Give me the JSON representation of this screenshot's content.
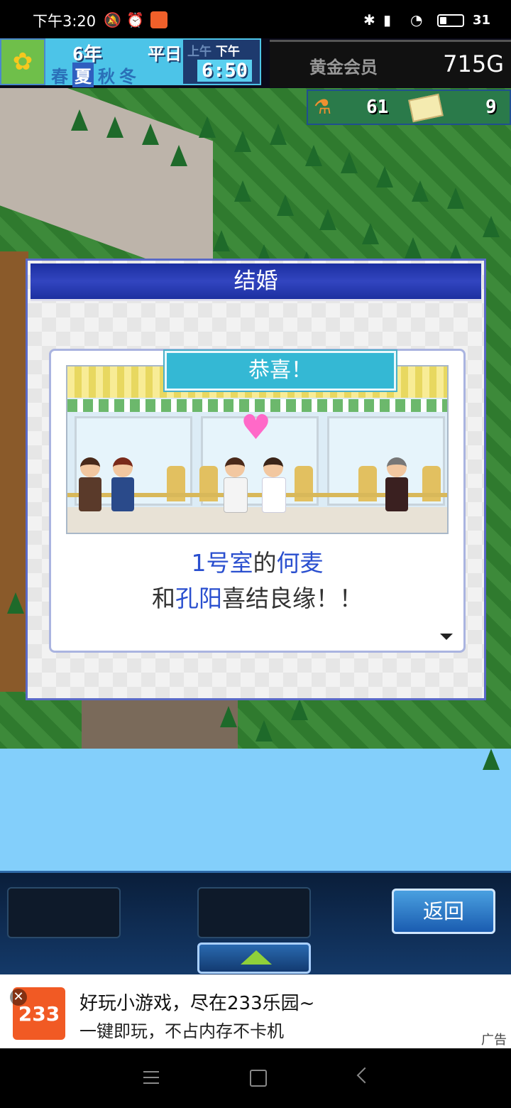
{
  "status_bar": {
    "time": "下午3:20",
    "icons": [
      "mute-icon",
      "alarm-icon",
      "app-badge-icon",
      "bluetooth-icon",
      "signal-icon",
      "wifi-icon",
      "battery-icon"
    ],
    "battery_percent": "31",
    "battery_level": 0.31
  },
  "hud": {
    "season_icon": "sunflower-icon",
    "year": "6年",
    "weekday": "平日",
    "seasons": [
      "春",
      "夏",
      "秋",
      "冬"
    ],
    "active_season": "夏",
    "ampm": [
      "上午",
      "下午"
    ],
    "active_ampm": "下午",
    "clock": "6:50",
    "member_label": "黄金会员",
    "gold": "715G",
    "research_points": "61",
    "tickets": "9"
  },
  "dialog": {
    "title": "结婚",
    "banner": "恭喜！",
    "message_line1": {
      "room": "1号室",
      "connector": "的",
      "name": "何麦"
    },
    "message_line2": {
      "prefix": "和",
      "name": "孔阳",
      "suffix": "喜结良缘！！"
    }
  },
  "bottom_hud": {
    "back_label": "返回"
  },
  "ad": {
    "logo_text": "233",
    "line1": "好玩小游戏，尽在233乐园~",
    "line2": "一键即玩，不占内存不卡机",
    "tag": "广告"
  },
  "colors": {
    "dialog_title_bg": "#1c2fa0",
    "banner_bg": "#34b8d4",
    "highlight_text": "#2a4fcf",
    "heart": "#ff69c8",
    "ad_logo": "#f15a24"
  }
}
